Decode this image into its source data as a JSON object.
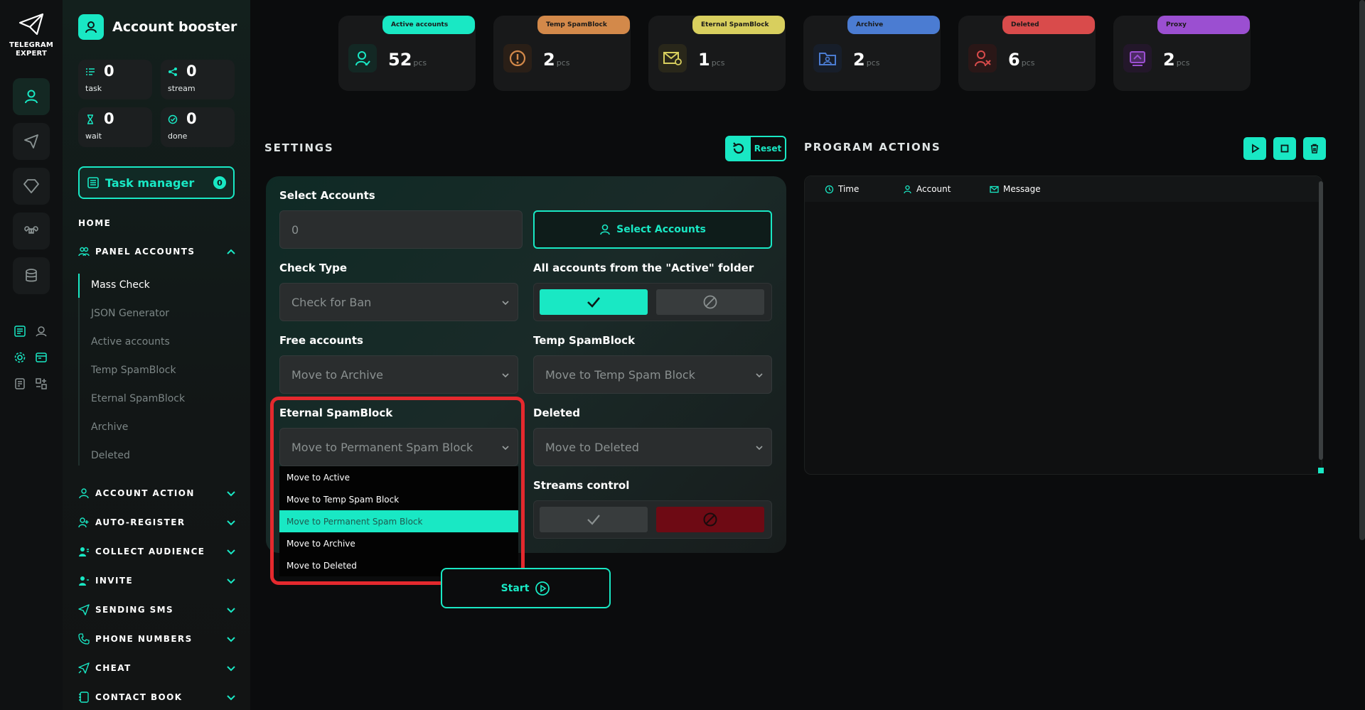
{
  "app": {
    "logo_line1": "TELEGRAM",
    "logo_line2": "EXPERT",
    "brand_title": "Account booster"
  },
  "counters": [
    {
      "value": "0",
      "label": "task"
    },
    {
      "value": "0",
      "label": "stream"
    },
    {
      "value": "0",
      "label": "wait"
    },
    {
      "value": "0",
      "label": "done"
    }
  ],
  "task_manager": {
    "label": "Task manager",
    "count": "0"
  },
  "nav": {
    "home": "HOME",
    "panel_accounts": "PANEL ACCOUNTS",
    "sub_items": [
      "Mass Check",
      "JSON Generator",
      "Active accounts",
      "Temp SpamBlock",
      "Eternal SpamBlock",
      "Archive",
      "Deleted"
    ],
    "sections": [
      "ACCOUNT ACTION",
      "AUTO-REGISTER",
      "COLLECT AUDIENCE",
      "INVITE",
      "SENDING SMS",
      "PHONE NUMBERS",
      "CHEAT",
      "CONTACT BOOK"
    ]
  },
  "cards": [
    {
      "label": "Active accounts",
      "value": "52",
      "unit": "pcs",
      "color": "#19e8c4",
      "icon": "user-icon"
    },
    {
      "label": "Temp SpamBlock",
      "value": "2",
      "unit": "pcs",
      "color": "#d3894a",
      "icon": "warning-icon"
    },
    {
      "label": "Eternal SpamBlock",
      "value": "1",
      "unit": "pcs",
      "color": "#d8cf5e",
      "icon": "mail-block-icon"
    },
    {
      "label": "Archive",
      "value": "2",
      "unit": "pcs",
      "color": "#4b7cd2",
      "icon": "archive-folder-icon"
    },
    {
      "label": "Deleted",
      "value": "6",
      "unit": "pcs",
      "color": "#d94b4b",
      "icon": "user-delete-icon"
    },
    {
      "label": "Proxy",
      "value": "2",
      "unit": "pcs",
      "color": "#9b4fd1",
      "icon": "proxy-icon"
    }
  ],
  "settings": {
    "title": "SETTINGS",
    "reset_label": "Reset",
    "select_accounts_label": "Select Accounts",
    "select_accounts_value": "0",
    "select_accounts_button": "Select Accounts",
    "check_type_label": "Check Type",
    "check_type_value": "Check for Ban",
    "active_folder_label": "All accounts from the \"Active\" folder",
    "free_accounts_label": "Free accounts",
    "free_accounts_value": "Move to Archive",
    "temp_spam_label": "Temp SpamBlock",
    "temp_spam_value": "Move to Temp Spam Block",
    "eternal_spam_label": "Eternal SpamBlock",
    "eternal_spam_value": "Move to Permanent Spam Block",
    "deleted_label": "Deleted",
    "deleted_value": "Move to Deleted",
    "streams_label": "Streams control",
    "dropdown_options": [
      "Move to Active",
      "Move to Temp Spam Block",
      "Move to Permanent Spam Block",
      "Move to Archive",
      "Move to Deleted"
    ],
    "dropdown_selected": "Move to Permanent Spam Block",
    "start_label": "Start"
  },
  "program_actions": {
    "title": "PROGRAM ACTIONS",
    "columns": [
      "Time",
      "Account",
      "Message"
    ]
  },
  "colors": {
    "accent": "#19e8c4",
    "danger": "#6e0a14",
    "highlight": "#e4292e"
  }
}
